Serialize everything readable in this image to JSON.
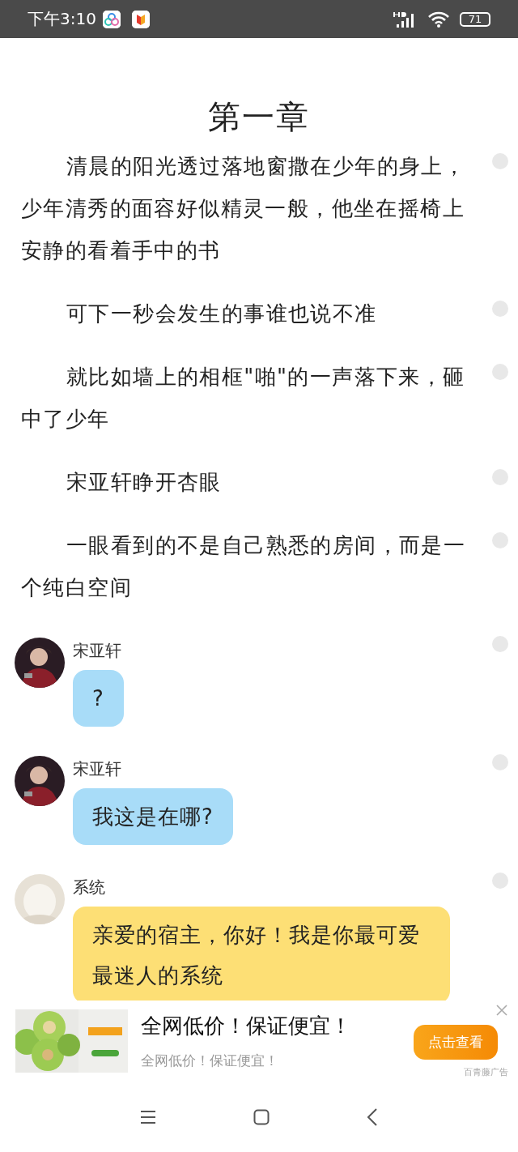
{
  "status_bar": {
    "time": "下午3:10",
    "battery": "71"
  },
  "chapter_title": "第一章",
  "blocks": [
    {
      "kind": "paragraph",
      "text": "清晨的阳光透过落地窗撒在少年的身上，少年清秀的面容好似精灵一般，他坐在摇椅上安静的看着手中的书"
    },
    {
      "kind": "paragraph",
      "text": "可下一秒会发生的事谁也说不准"
    },
    {
      "kind": "paragraph",
      "text": "就比如墙上的相框\"啪\"的一声落下来，砸中了少年"
    },
    {
      "kind": "paragraph",
      "text": "宋亚轩睁开杏眼"
    },
    {
      "kind": "paragraph",
      "text": "一眼看到的不是自己熟悉的房间，而是一个纯白空间"
    },
    {
      "kind": "message",
      "sender": "宋亚轩",
      "text": "?",
      "color": "#a8dcf8"
    },
    {
      "kind": "message",
      "sender": "宋亚轩",
      "text": "我这是在哪?",
      "color": "#a8dcf8"
    },
    {
      "kind": "message",
      "sender": "系统",
      "text": "亲爱的宿主，你好！我是你最可爱最迷人的系统",
      "color": "#fddf75"
    }
  ],
  "ad": {
    "title": "全网低价！保证便宜！",
    "subtitle": "全网低价！保证便宜！",
    "button": "点击查看",
    "source": "百青藤广告"
  }
}
